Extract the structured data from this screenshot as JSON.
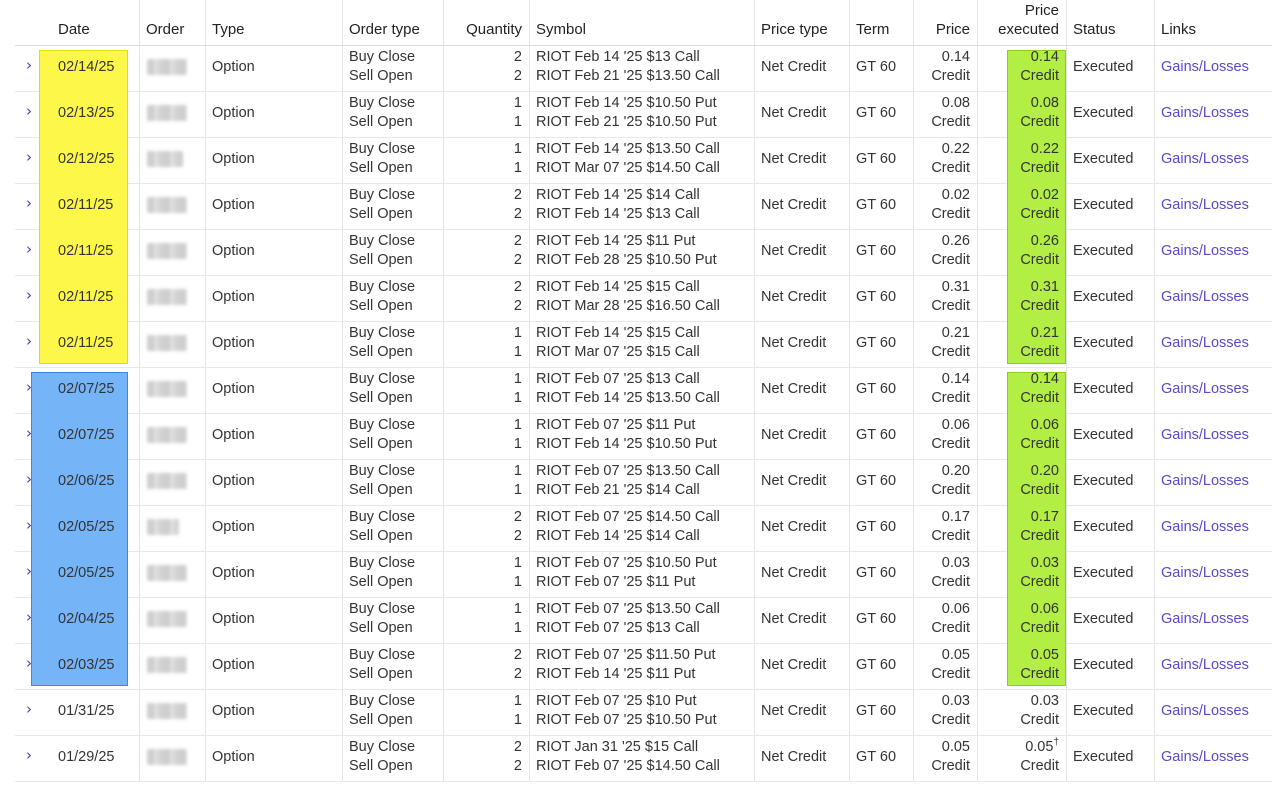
{
  "columns": {
    "date": "Date",
    "order": "Order",
    "type": "Type",
    "order_type": "Order type",
    "quantity": "Quantity",
    "symbol": "Symbol",
    "price_type": "Price type",
    "term": "Term",
    "price": "Price",
    "price_executed_line1": "Price",
    "price_executed_line2": "executed",
    "status": "Status",
    "links": "Links"
  },
  "expand_glyph": "›",
  "highlight_colors": {
    "yellow": "#fdf74a",
    "blue": "#75b4f7",
    "green": "#b3ee44"
  },
  "rows": [
    {
      "date": "02/14/25",
      "type": "Option",
      "order_types": [
        "Buy Close",
        "Sell Open"
      ],
      "quantities": [
        "2",
        "2"
      ],
      "symbols": [
        "RIOT Feb 14 '25 $13 Call",
        "RIOT Feb 21 '25 $13.50 Call"
      ],
      "price_type": "Net Credit",
      "term": "GT 60",
      "price": "0.14",
      "price_unit": "Credit",
      "executed": "0.14",
      "executed_mark": "",
      "executed_unit": "Credit",
      "status": "Executed",
      "link": "Gains/Losses",
      "date_highlight": "yellow"
    },
    {
      "date": "02/13/25",
      "type": "Option",
      "order_types": [
        "Buy Close",
        "Sell Open"
      ],
      "quantities": [
        "1",
        "1"
      ],
      "symbols": [
        "RIOT Feb 14 '25 $10.50 Put",
        "RIOT Feb 21 '25 $10.50 Put"
      ],
      "price_type": "Net Credit",
      "term": "GT 60",
      "price": "0.08",
      "price_unit": "Credit",
      "executed": "0.08",
      "executed_mark": "",
      "executed_unit": "Credit",
      "status": "Executed",
      "link": "Gains/Losses",
      "date_highlight": "yellow"
    },
    {
      "date": "02/12/25",
      "type": "Option",
      "order_types": [
        "Buy Close",
        "Sell Open"
      ],
      "quantities": [
        "1",
        "1"
      ],
      "symbols": [
        "RIOT Feb 14 '25 $13.50 Call",
        "RIOT Mar 07 '25 $14.50 Call"
      ],
      "price_type": "Net Credit",
      "term": "GT 60",
      "price": "0.22",
      "price_unit": "Credit",
      "executed": "0.22",
      "executed_mark": "",
      "executed_unit": "Credit",
      "status": "Executed",
      "link": "Gains/Losses",
      "date_highlight": "yellow"
    },
    {
      "date": "02/11/25",
      "type": "Option",
      "order_types": [
        "Buy Close",
        "Sell Open"
      ],
      "quantities": [
        "2",
        "2"
      ],
      "symbols": [
        "RIOT Feb 14 '25 $14 Call",
        "RIOT Feb 14 '25 $13 Call"
      ],
      "price_type": "Net Credit",
      "term": "GT 60",
      "price": "0.02",
      "price_unit": "Credit",
      "executed": "0.02",
      "executed_mark": "",
      "executed_unit": "Credit",
      "status": "Executed",
      "link": "Gains/Losses",
      "date_highlight": "yellow"
    },
    {
      "date": "02/11/25",
      "type": "Option",
      "order_types": [
        "Buy Close",
        "Sell Open"
      ],
      "quantities": [
        "2",
        "2"
      ],
      "symbols": [
        "RIOT Feb 14 '25 $11 Put",
        "RIOT Feb 28 '25 $10.50 Put"
      ],
      "price_type": "Net Credit",
      "term": "GT 60",
      "price": "0.26",
      "price_unit": "Credit",
      "executed": "0.26",
      "executed_mark": "",
      "executed_unit": "Credit",
      "status": "Executed",
      "link": "Gains/Losses",
      "date_highlight": "yellow"
    },
    {
      "date": "02/11/25",
      "type": "Option",
      "order_types": [
        "Buy Close",
        "Sell Open"
      ],
      "quantities": [
        "2",
        "2"
      ],
      "symbols": [
        "RIOT Feb 14 '25 $15 Call",
        "RIOT Mar 28 '25 $16.50 Call"
      ],
      "price_type": "Net Credit",
      "term": "GT 60",
      "price": "0.31",
      "price_unit": "Credit",
      "executed": "0.31",
      "executed_mark": "",
      "executed_unit": "Credit",
      "status": "Executed",
      "link": "Gains/Losses",
      "date_highlight": "yellow"
    },
    {
      "date": "02/11/25",
      "type": "Option",
      "order_types": [
        "Buy Close",
        "Sell Open"
      ],
      "quantities": [
        "1",
        "1"
      ],
      "symbols": [
        "RIOT Feb 14 '25 $15 Call",
        "RIOT Mar 07 '25 $15 Call"
      ],
      "price_type": "Net Credit",
      "term": "GT 60",
      "price": "0.21",
      "price_unit": "Credit",
      "executed": "0.21",
      "executed_mark": "",
      "executed_unit": "Credit",
      "status": "Executed",
      "link": "Gains/Losses",
      "date_highlight": "yellow"
    },
    {
      "date": "02/07/25",
      "type": "Option",
      "order_types": [
        "Buy Close",
        "Sell Open"
      ],
      "quantities": [
        "1",
        "1"
      ],
      "symbols": [
        "RIOT Feb 07 '25 $13 Call",
        "RIOT Feb 14 '25 $13.50 Call"
      ],
      "price_type": "Net Credit",
      "term": "GT 60",
      "price": "0.14",
      "price_unit": "Credit",
      "executed": "0.14",
      "executed_mark": "",
      "executed_unit": "Credit",
      "status": "Executed",
      "link": "Gains/Losses",
      "date_highlight": "blue"
    },
    {
      "date": "02/07/25",
      "type": "Option",
      "order_types": [
        "Buy Close",
        "Sell Open"
      ],
      "quantities": [
        "1",
        "1"
      ],
      "symbols": [
        "RIOT Feb 07 '25 $11 Put",
        "RIOT Feb 14 '25 $10.50 Put"
      ],
      "price_type": "Net Credit",
      "term": "GT 60",
      "price": "0.06",
      "price_unit": "Credit",
      "executed": "0.06",
      "executed_mark": "",
      "executed_unit": "Credit",
      "status": "Executed",
      "link": "Gains/Losses",
      "date_highlight": "blue"
    },
    {
      "date": "02/06/25",
      "type": "Option",
      "order_types": [
        "Buy Close",
        "Sell Open"
      ],
      "quantities": [
        "1",
        "1"
      ],
      "symbols": [
        "RIOT Feb 07 '25 $13.50 Call",
        "RIOT Feb 21 '25 $14 Call"
      ],
      "price_type": "Net Credit",
      "term": "GT 60",
      "price": "0.20",
      "price_unit": "Credit",
      "executed": "0.20",
      "executed_mark": "",
      "executed_unit": "Credit",
      "status": "Executed",
      "link": "Gains/Losses",
      "date_highlight": "blue"
    },
    {
      "date": "02/05/25",
      "type": "Option",
      "order_types": [
        "Buy Close",
        "Sell Open"
      ],
      "quantities": [
        "2",
        "2"
      ],
      "symbols": [
        "RIOT Feb 07 '25 $14.50 Call",
        "RIOT Feb 14 '25 $14 Call"
      ],
      "price_type": "Net Credit",
      "term": "GT 60",
      "price": "0.17",
      "price_unit": "Credit",
      "executed": "0.17",
      "executed_mark": "",
      "executed_unit": "Credit",
      "status": "Executed",
      "link": "Gains/Losses",
      "date_highlight": "blue"
    },
    {
      "date": "02/05/25",
      "type": "Option",
      "order_types": [
        "Buy Close",
        "Sell Open"
      ],
      "quantities": [
        "1",
        "1"
      ],
      "symbols": [
        "RIOT Feb 07 '25 $10.50 Put",
        "RIOT Feb 07 '25 $11 Put"
      ],
      "price_type": "Net Credit",
      "term": "GT 60",
      "price": "0.03",
      "price_unit": "Credit",
      "executed": "0.03",
      "executed_mark": "",
      "executed_unit": "Credit",
      "status": "Executed",
      "link": "Gains/Losses",
      "date_highlight": "blue"
    },
    {
      "date": "02/04/25",
      "type": "Option",
      "order_types": [
        "Buy Close",
        "Sell Open"
      ],
      "quantities": [
        "1",
        "1"
      ],
      "symbols": [
        "RIOT Feb 07 '25 $13.50 Call",
        "RIOT Feb 07 '25 $13 Call"
      ],
      "price_type": "Net Credit",
      "term": "GT 60",
      "price": "0.06",
      "price_unit": "Credit",
      "executed": "0.06",
      "executed_mark": "",
      "executed_unit": "Credit",
      "status": "Executed",
      "link": "Gains/Losses",
      "date_highlight": "blue"
    },
    {
      "date": "02/03/25",
      "type": "Option",
      "order_types": [
        "Buy Close",
        "Sell Open"
      ],
      "quantities": [
        "2",
        "2"
      ],
      "symbols": [
        "RIOT Feb 07 '25 $11.50 Put",
        "RIOT Feb 14 '25 $11 Put"
      ],
      "price_type": "Net Credit",
      "term": "GT 60",
      "price": "0.05",
      "price_unit": "Credit",
      "executed": "0.05",
      "executed_mark": "",
      "executed_unit": "Credit",
      "status": "Executed",
      "link": "Gains/Losses",
      "date_highlight": "blue"
    },
    {
      "date": "01/31/25",
      "type": "Option",
      "order_types": [
        "Buy Close",
        "Sell Open"
      ],
      "quantities": [
        "1",
        "1"
      ],
      "symbols": [
        "RIOT Feb 07 '25 $10 Put",
        "RIOT Feb 07 '25 $10.50 Put"
      ],
      "price_type": "Net Credit",
      "term": "GT 60",
      "price": "0.03",
      "price_unit": "Credit",
      "executed": "0.03",
      "executed_mark": "",
      "executed_unit": "Credit",
      "status": "Executed",
      "link": "Gains/Losses",
      "date_highlight": ""
    },
    {
      "date": "01/29/25",
      "type": "Option",
      "order_types": [
        "Buy Close",
        "Sell Open"
      ],
      "quantities": [
        "2",
        "2"
      ],
      "symbols": [
        "RIOT Jan 31 '25 $15 Call",
        "RIOT Feb 07 '25 $14.50 Call"
      ],
      "price_type": "Net Credit",
      "term": "GT 60",
      "price": "0.05",
      "price_unit": "Credit",
      "executed": "0.05",
      "executed_mark": "†",
      "executed_unit": "Credit",
      "status": "Executed",
      "link": "Gains/Losses",
      "date_highlight": ""
    }
  ]
}
